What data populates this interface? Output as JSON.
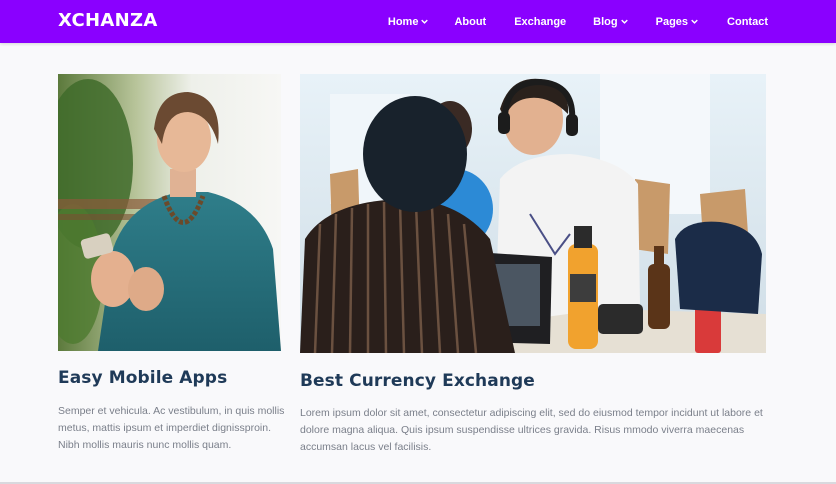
{
  "brand": "XCHANZA",
  "nav": {
    "items": [
      {
        "label": "Home",
        "dropdown": true
      },
      {
        "label": "About",
        "dropdown": false
      },
      {
        "label": "Exchange",
        "dropdown": false
      },
      {
        "label": "Blog",
        "dropdown": true
      },
      {
        "label": "Pages",
        "dropdown": true
      },
      {
        "label": "Contact",
        "dropdown": false
      }
    ]
  },
  "cards": [
    {
      "title": "Easy Mobile Apps",
      "text": "Semper et vehicula. Ac vestibulum, in quis mollis metus, mattis ipsum et imperdiet dignissproin. Nibh mollis mauris nunc mollis quam."
    },
    {
      "title": "Best Currency Exchange",
      "text": "Lorem ipsum dolor sit amet, consectetur adipiscing elit, sed do eiusmod tempor incidunt ut labore et dolore magna aliqua. Quis ipsum suspendisse ultrices gravida. Risus mmodo viverra maecenas accumsan lacus vel facilisis."
    }
  ],
  "colors": {
    "navbar": "#8a00ff",
    "title": "#1f3a58",
    "text": "#7a7f8a"
  }
}
